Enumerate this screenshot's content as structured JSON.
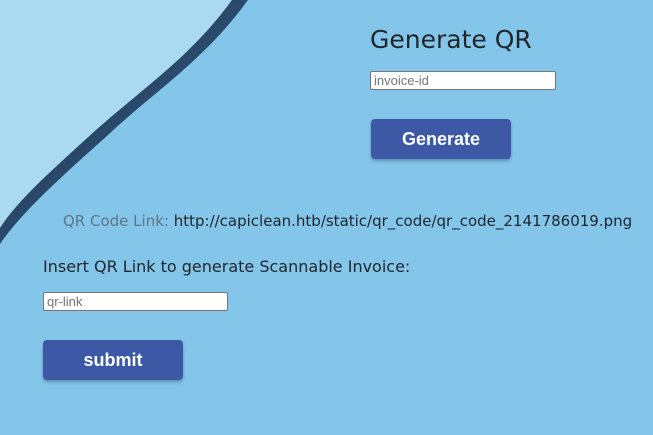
{
  "generate_section": {
    "title": "Generate QR",
    "invoice_placeholder": "invoice-id",
    "invoice_value": "",
    "button_label": "Generate"
  },
  "qr_link": {
    "label": "QR Code Link:",
    "url": "http://capiclean.htb/static/qr_code/qr_code_2141786019.png"
  },
  "scannable_section": {
    "instruction": "Insert QR Link to generate Scannable Invoice:",
    "link_placeholder": "qr-link",
    "link_value": "",
    "button_label": "submit"
  },
  "colors": {
    "background": "#84c6e9",
    "page_curl_light": "#a9daef",
    "page_curl_shadow": "#1a2f4a",
    "button": "#3d58a4",
    "button_text": "#ffffff",
    "label_muted": "#5e7585",
    "text": "#1f252b"
  }
}
